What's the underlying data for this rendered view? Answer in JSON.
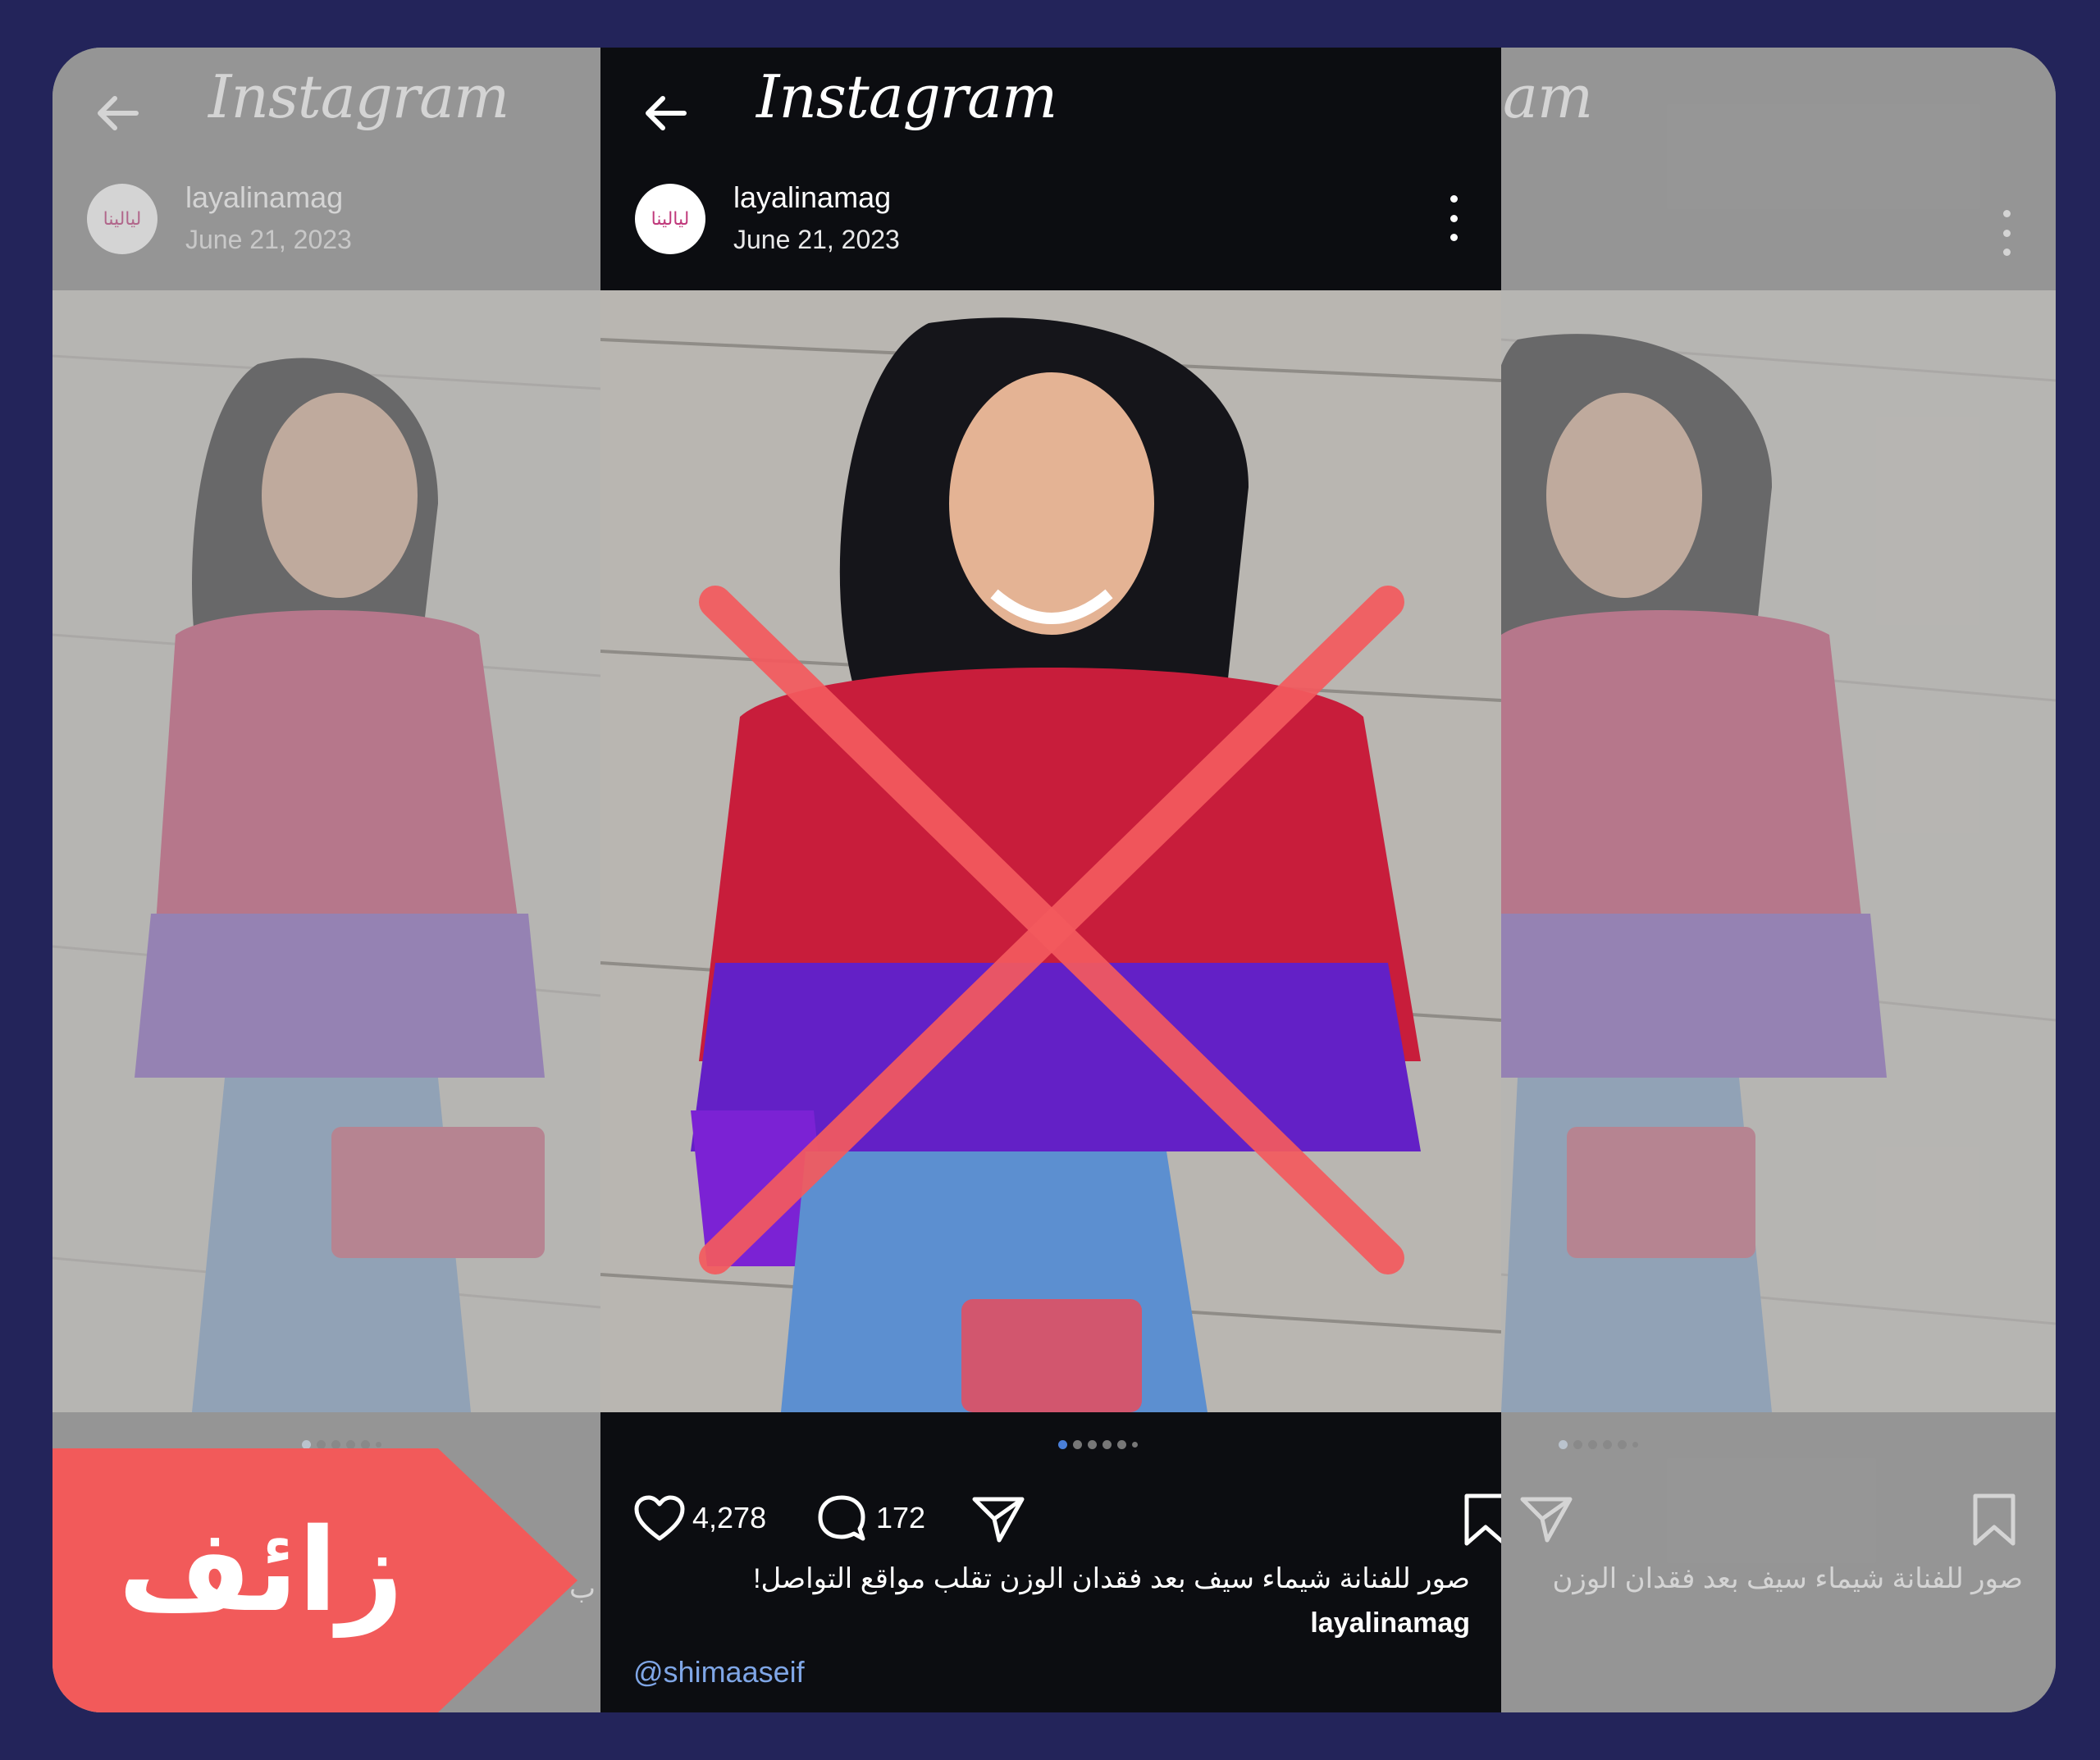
{
  "app": {
    "brand": "Instagram"
  },
  "post": {
    "username": "layalinamag",
    "date": "June 21, 2023",
    "avatar_text": "ليالينا",
    "likes": "4,278",
    "comments": "172",
    "caption_user": "layalinamag",
    "caption_text": "صور للفنانة شيماء سيف بعد فقدان الوزن تقلب مواقع التواصل!",
    "mention": "@shimaaseif",
    "carousel_pages": 6,
    "carousel_active": 1
  },
  "side_panels": {
    "left_brand": "Instagram",
    "right_brand_fragment": "am",
    "right_caption_fragment": "صور للفنانة شيماء سيف بعد فقدان الوزن",
    "left_caption_fragment": "ب"
  },
  "verdict": {
    "label": "زائف",
    "color": "#f25a5a"
  },
  "icons": [
    "back-arrow-icon",
    "more-icon",
    "heart-icon",
    "comment-icon",
    "share-icon",
    "bookmark-icon"
  ]
}
